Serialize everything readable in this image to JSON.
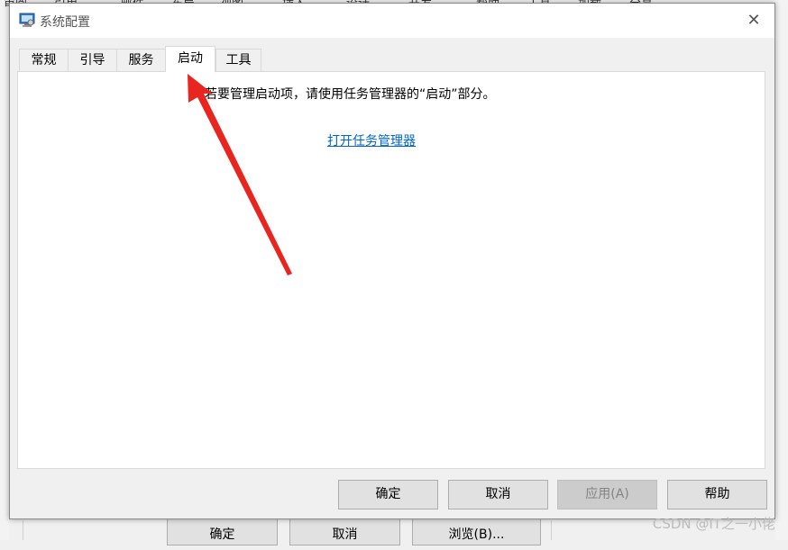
{
  "background_app": {
    "menu_items": [
      "审阅",
      "引用",
      "邮件",
      "布局",
      "视图",
      "插入",
      "设计",
      "开发",
      "帮助",
      "工具",
      "加载",
      "分享"
    ],
    "bottom_buttons": [
      "确定",
      "取消",
      "浏览(B)..."
    ]
  },
  "dialog": {
    "title": "系统配置",
    "close_icon": "close-icon",
    "app_icon": "msconfig-icon",
    "tabs": [
      {
        "label": "常规",
        "active": false
      },
      {
        "label": "引导",
        "active": false
      },
      {
        "label": "服务",
        "active": false
      },
      {
        "label": "启动",
        "active": true
      },
      {
        "label": "工具",
        "active": false
      }
    ],
    "startup_tab": {
      "info_text": "若要管理启动项，请使用任务管理器的“启动”部分。",
      "link_text": "打开任务管理器"
    },
    "buttons": {
      "ok": "确定",
      "cancel": "取消",
      "apply": "应用(A)",
      "help": "帮助"
    }
  },
  "annotation": {
    "color": "#e8261f"
  },
  "colors": {
    "link": "#0066cc",
    "window_bg": "#f0f0f0",
    "content_bg": "#ffffff"
  },
  "watermark": "CSDN @IT之一小佬"
}
